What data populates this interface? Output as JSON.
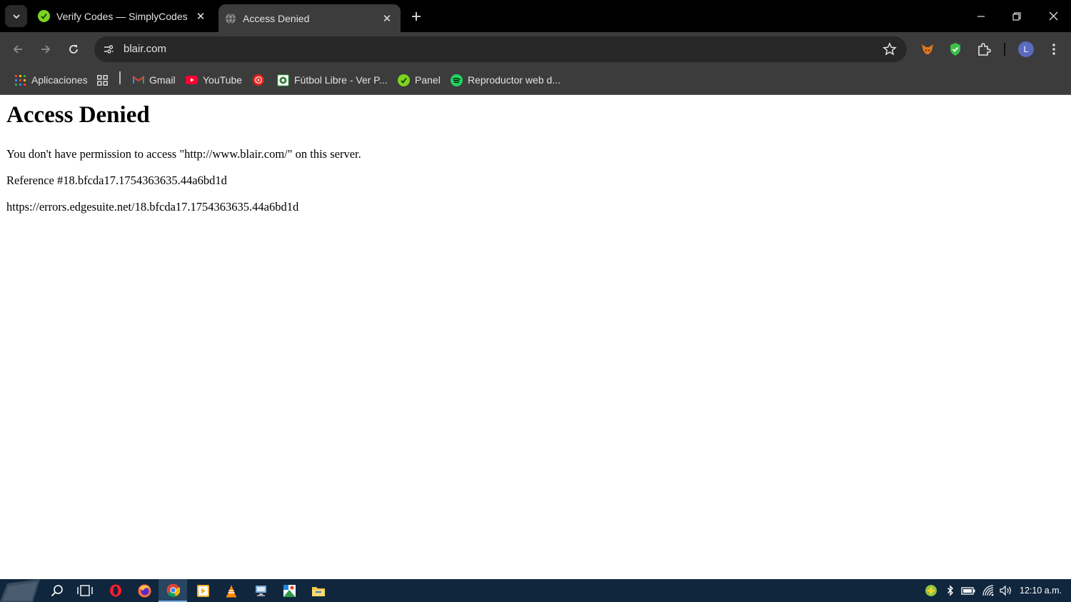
{
  "tabs": [
    {
      "title": "Verify Codes — SimplyCodes",
      "favicon": "simplycodes-icon",
      "active": false
    },
    {
      "title": "Access Denied",
      "favicon": "globe-icon",
      "active": true
    }
  ],
  "omnibox": {
    "url": "blair.com"
  },
  "bookmarks": [
    {
      "label": "Aplicaciones",
      "icon": "apps-grid-icon"
    },
    {
      "label": "",
      "icon": "grid-icon"
    },
    {
      "label": "Gmail",
      "icon": "gmail-icon"
    },
    {
      "label": "YouTube",
      "icon": "youtube-icon"
    },
    {
      "label": "",
      "icon": "music-icon"
    },
    {
      "label": "Fútbol Libre - Ver P...",
      "icon": "soccer-icon"
    },
    {
      "label": "Panel",
      "icon": "simplycodes-icon"
    },
    {
      "label": "Reproductor web d...",
      "icon": "spotify-icon"
    }
  ],
  "profile": {
    "initial": "L"
  },
  "page": {
    "heading": "Access Denied",
    "message": "You don't have permission to access \"http://www.blair.com/\" on this server.",
    "reference": "Reference #18.bfcda17.1754363635.44a6bd1d",
    "error_url": "https://errors.edgesuite.net/18.bfcda17.1754363635.44a6bd1d"
  },
  "taskbar": {
    "clock": "12:10 a.m.",
    "pinned": [
      "search-icon",
      "task-view-icon",
      "opera-icon",
      "firefox-icon",
      "chrome-icon",
      "media-player-icon",
      "vlc-icon",
      "network-app-icon",
      "paint-icon",
      "file-explorer-icon"
    ],
    "active": "chrome-icon"
  },
  "colors": {
    "tab_bg": "#000000",
    "toolbar_bg": "#3c3c3c",
    "omnibox_bg": "#282828",
    "taskbar_bg": "#10263d",
    "accent_green": "#7ed321"
  }
}
